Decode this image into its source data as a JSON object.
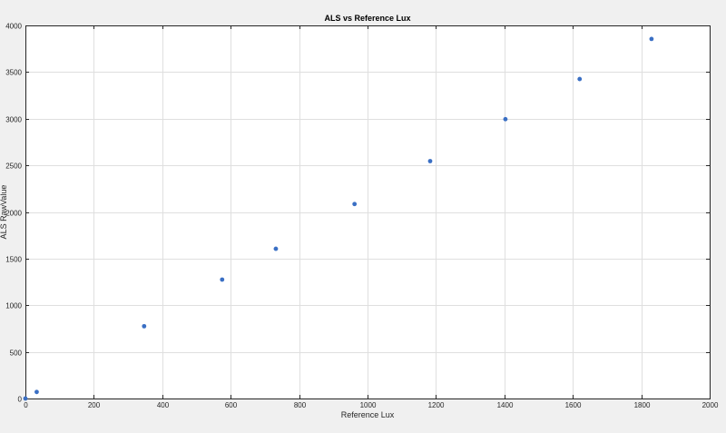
{
  "chart_data": {
    "type": "scatter",
    "title": "ALS vs Reference Lux",
    "xlabel": "Reference Lux",
    "ylabel": "ALS RawValue",
    "xlim": [
      0,
      2000
    ],
    "ylim": [
      0,
      4000
    ],
    "xticks": [
      0,
      200,
      400,
      600,
      800,
      1000,
      1200,
      1400,
      1600,
      1800,
      2000
    ],
    "yticks": [
      0,
      500,
      1000,
      1500,
      2000,
      2500,
      3000,
      3500,
      4000
    ],
    "grid": true,
    "legend": "none",
    "series": [
      {
        "color": "#3a6fc4",
        "points": [
          {
            "x": 0,
            "y": 0
          },
          {
            "x": 33,
            "y": 70
          },
          {
            "x": 347,
            "y": 775
          },
          {
            "x": 575,
            "y": 1275
          },
          {
            "x": 732,
            "y": 1605
          },
          {
            "x": 962,
            "y": 2085
          },
          {
            "x": 1183,
            "y": 2545
          },
          {
            "x": 1403,
            "y": 2995
          },
          {
            "x": 1620,
            "y": 3425
          },
          {
            "x": 1830,
            "y": 3855
          }
        ]
      }
    ]
  }
}
